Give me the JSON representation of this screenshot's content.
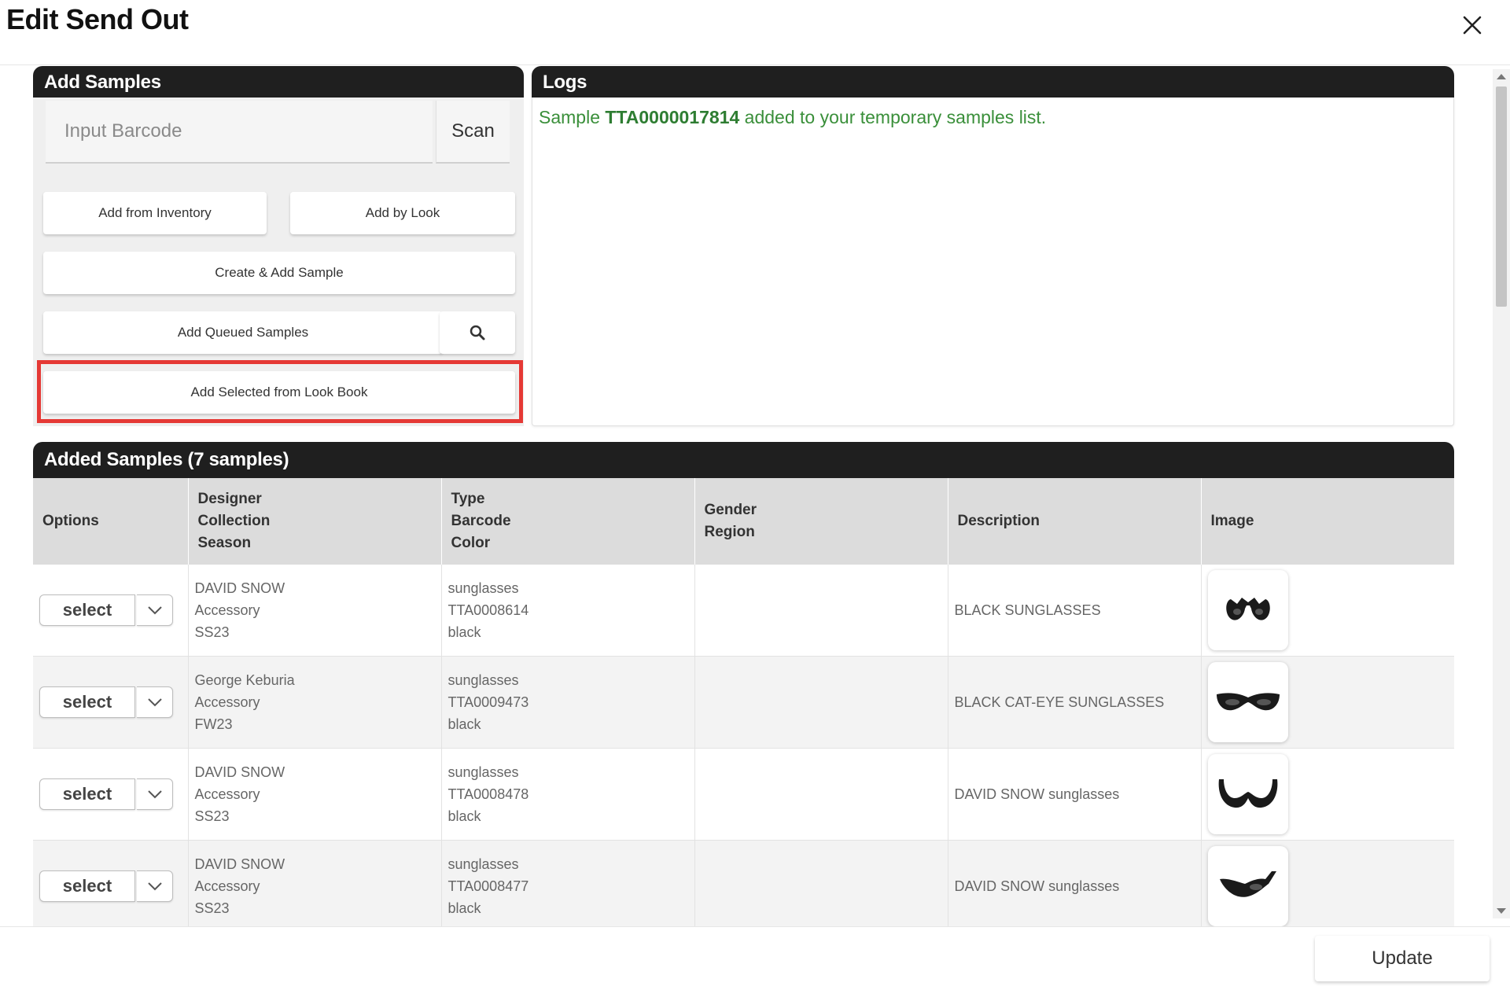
{
  "dialog": {
    "title": "Edit Send Out",
    "close_icon": "close-icon"
  },
  "add_samples": {
    "header": "Add Samples",
    "barcode_placeholder": "Input Barcode",
    "scan_label": "Scan",
    "add_from_inventory": "Add from Inventory",
    "add_by_look": "Add by Look",
    "create_add_sample": "Create & Add Sample",
    "add_queued_samples": "Add Queued Samples",
    "search_icon": "search-icon",
    "add_selected_look_book": "Add Selected from Look Book",
    "highlight_color": "#e53935"
  },
  "logs": {
    "header": "Logs",
    "entry": {
      "prefix": "Sample ",
      "code": "TTA0000017814",
      "suffix": " added to your temporary samples list."
    },
    "text_color": "#3a8f3a"
  },
  "added_samples": {
    "header": "Added Samples (7 samples)",
    "columns": {
      "options": "Options",
      "dcs": [
        "Designer",
        "Collection",
        "Season"
      ],
      "tbc": [
        "Type",
        "Barcode",
        "Color"
      ],
      "gr": [
        "Gender",
        "Region"
      ],
      "description": "Description",
      "image": "Image"
    },
    "rows": [
      {
        "select_label": "select",
        "designer": "DAVID SNOW",
        "collection": "Accessory",
        "season": "SS23",
        "type": "sunglasses",
        "barcode": "TTA0008614",
        "color": "black",
        "description": "BLACK SUNGLASSES"
      },
      {
        "select_label": "select",
        "designer": "George Keburia",
        "collection": "Accessory",
        "season": "FW23",
        "type": "sunglasses",
        "barcode": "TTA0009473",
        "color": "black",
        "description": "BLACK CAT-EYE SUNGLASSES"
      },
      {
        "select_label": "select",
        "designer": "DAVID SNOW",
        "collection": "Accessory",
        "season": "SS23",
        "type": "sunglasses",
        "barcode": "TTA0008478",
        "color": "black",
        "description": "DAVID SNOW sunglasses"
      },
      {
        "select_label": "select",
        "designer": "DAVID SNOW",
        "collection": "Accessory",
        "season": "SS23",
        "type": "sunglasses",
        "barcode": "TTA0008477",
        "color": "black",
        "description": "DAVID SNOW sunglasses"
      }
    ]
  },
  "footer": {
    "update_label": "Update"
  },
  "colors": {
    "header_bg": "#1f1f1f",
    "table_header_bg": "#dcdcdc"
  }
}
